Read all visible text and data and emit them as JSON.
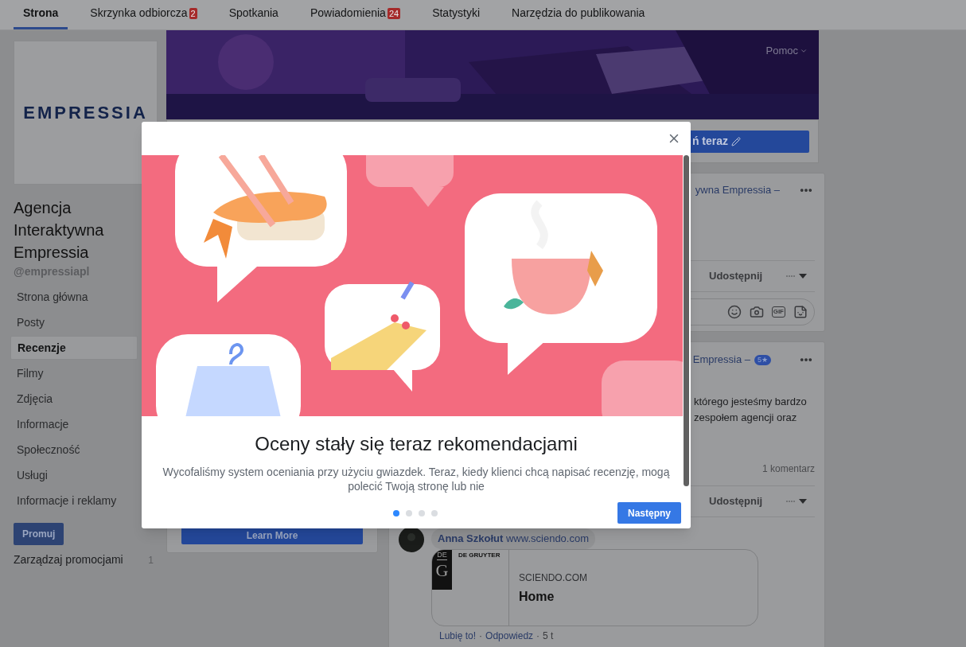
{
  "tabs": [
    {
      "label": "Strona",
      "selected": true
    },
    {
      "label": "Skrzynka odbiorcza",
      "badge": "2",
      "selected": false
    },
    {
      "label": "Spotkania",
      "selected": false
    },
    {
      "label": "Powiadomienia",
      "badge": "24",
      "selected": false
    },
    {
      "label": "Statystyki",
      "selected": false
    },
    {
      "label": "Narzędzia do publikowania",
      "selected": false
    }
  ],
  "cover": {
    "kind": "picture",
    "menu": "Pomoc"
  },
  "cta_button": "ń teraz",
  "profile": {
    "logo": "EMPRESSIA",
    "name": "Agencja Interaktywna Empressia",
    "handle": "@empressiapl"
  },
  "sidebar": {
    "items": [
      {
        "label": "Strona główna",
        "selected": false
      },
      {
        "label": "Posty",
        "selected": false
      },
      {
        "label": "Recenzje",
        "selected": true
      },
      {
        "label": "Filmy",
        "selected": false
      },
      {
        "label": "Zdjęcia",
        "selected": false
      },
      {
        "label": "Informacje",
        "selected": false
      },
      {
        "label": "Społeczność",
        "selected": false
      },
      {
        "label": "Usługi",
        "selected": false
      },
      {
        "label": "Informacje i reklamy",
        "selected": false
      }
    ],
    "promote_button": "Promuj",
    "manage_label": "Zarządzaj promocjami",
    "manage_count": "1"
  },
  "ad_card": {
    "button": "Learn More"
  },
  "post_1": {
    "title": "ywna Empressia –",
    "share": "Udostępnij",
    "gif_label": "GIF"
  },
  "post_2": {
    "title": "Empressia –",
    "rating": "5★",
    "lines": [
      "którego jesteśmy bardzo",
      "zespołem agencji oraz"
    ],
    "comments_count": "1 komentarz",
    "share": "Udostępnij",
    "comment": {
      "author": "Anna Szkołut",
      "text": "www.sciendo.com",
      "preview": {
        "logo_top": "DE",
        "logo_letter": "G",
        "publisher": "DE GRUYTER",
        "domain": "SCIENDO.COM",
        "title": "Home"
      },
      "actions": [
        "Lubię to!",
        "Odpowiedz",
        "5 t"
      ],
      "separator": "·"
    }
  },
  "dialog": {
    "title": "Oceny stały się teraz rekomendacjami",
    "text": "Wycofaliśmy system oceniania przy użyciu gwiazdek. Teraz, kiedy klienci chcą napisać recenzję, mogą polecić Twoją stronę lub nie",
    "pages": [
      {
        "selected": true
      },
      {
        "selected": false
      },
      {
        "selected": false
      },
      {
        "selected": false
      }
    ],
    "button": "Następny"
  }
}
